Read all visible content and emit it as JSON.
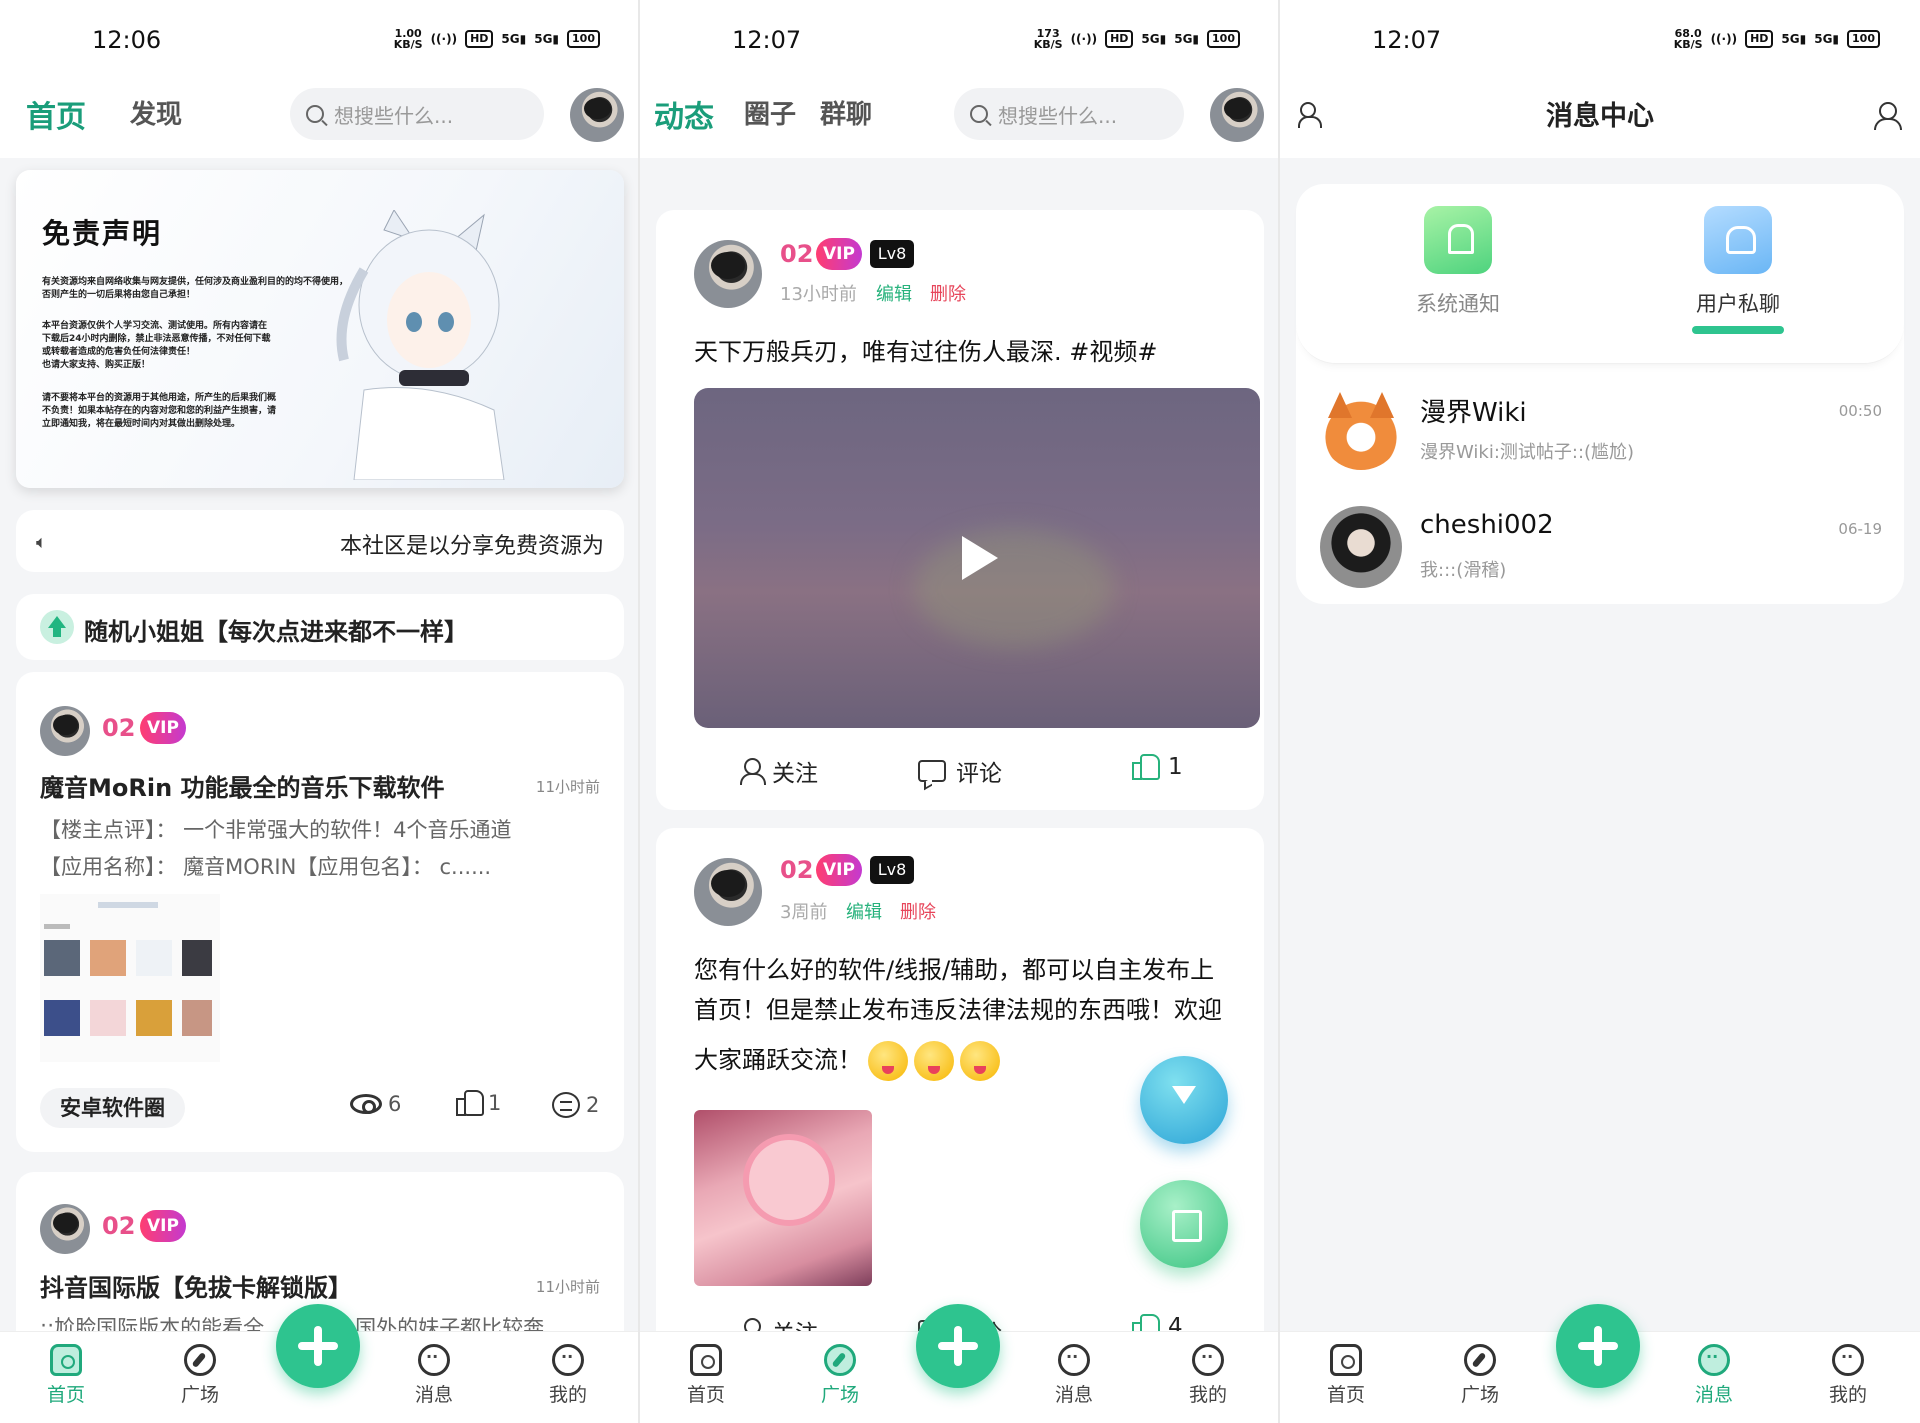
{
  "screen1": {
    "status": {
      "time": "12:06",
      "speed": "1.00",
      "speed_unit": "KB/S",
      "battery": "100"
    },
    "tabs": [
      "首页",
      "发现"
    ],
    "search_placeholder": "想搜些什么...",
    "banner": {
      "title": "免责声明",
      "lines": [
        "有关资源均来自网络收集与网友提供，任何涉及商业盈利目的的均不得使用，",
        "否则产生的一切后果将由您自己承担！",
        "本平台资源仅供个人学习交流、测试使用。所有内容请在",
        "下载后24小时内删除，禁止非法恶意传播，不对任何下载",
        "或转载者造成的危害负任何法律责任！",
        "也请大家支持、购买正版！",
        "请不要将本平台的资源用于其他用途，所产生的后果我们概",
        "不负责！如果本帖存在的内容对您和您的利益产生损害，请",
        "立即通知我，将在最短时间内对其做出删除处理。"
      ]
    },
    "notice": "本社区是以分享免费资源为",
    "random": "随机小姐姐【每次点进来都不一样】",
    "post1": {
      "user": "02",
      "vip": "VIP",
      "title": "魔音MoRin 功能最全的音乐下载软件",
      "time": "11小时前",
      "body1": "【楼主点评】：  一个非常强大的软件！4个音乐通道",
      "body2": "【应用名称】：  魔音MORIN【应用包名】：  c......",
      "tag": "安卓软件圈",
      "views": "6",
      "likes": "1",
      "comments": "2"
    },
    "post2": {
      "user": "02",
      "vip": "VIP",
      "title": "抖音国际版【免拔卡解锁版】",
      "time": "11小时前",
      "body1": "::尬脸国际版本的能看全",
      "body1_tail": "外国外的妹子都比较奔"
    },
    "nav": [
      "首页",
      "广场",
      "消息",
      "我的"
    ]
  },
  "screen2": {
    "status": {
      "time": "12:07",
      "speed": "173",
      "speed_unit": "KB/S",
      "battery": "100"
    },
    "tabs": [
      "动态",
      "圈子",
      "群聊"
    ],
    "search_placeholder": "想搜些什么...",
    "feed1": {
      "user": "02",
      "vip": "VIP",
      "level": "Lv8",
      "time": "13小时前",
      "edit": "编辑",
      "delete": "删除",
      "text": "天下万般兵刃，唯有过往伤人最深. #视频#",
      "follow": "关注",
      "comment": "评论",
      "likes": "1"
    },
    "feed2": {
      "user": "02",
      "vip": "VIP",
      "level": "Lv8",
      "time": "3周前",
      "edit": "编辑",
      "delete": "删除",
      "text1": "您有什么好的软件/线报/辅助，都可以自主发布上",
      "text2": "首页！但是禁止发布违反法律法规的东西哦！欢迎",
      "text3": "大家踊跃交流！",
      "follow": "关注",
      "comment": "评论",
      "likes": "4"
    },
    "nav": [
      "首页",
      "广场",
      "消息",
      "我的"
    ]
  },
  "screen3": {
    "status": {
      "time": "12:07",
      "speed": "68.0",
      "speed_unit": "KB/S",
      "battery": "100"
    },
    "title": "消息中心",
    "tabs": [
      "系统通知",
      "用户私聊"
    ],
    "conversations": [
      {
        "name": "漫界Wiki",
        "preview": "漫界Wiki:测试帖子::(尴尬)",
        "time": "00:50"
      },
      {
        "name": "cheshi002",
        "preview": "我:::(滑稽)",
        "time": "06-19"
      }
    ],
    "nav": [
      "首页",
      "广场",
      "消息",
      "我的"
    ]
  },
  "colors": {
    "accent": "#2ec48f",
    "vip_pink": "#e8508a",
    "danger": "#e7455a"
  }
}
